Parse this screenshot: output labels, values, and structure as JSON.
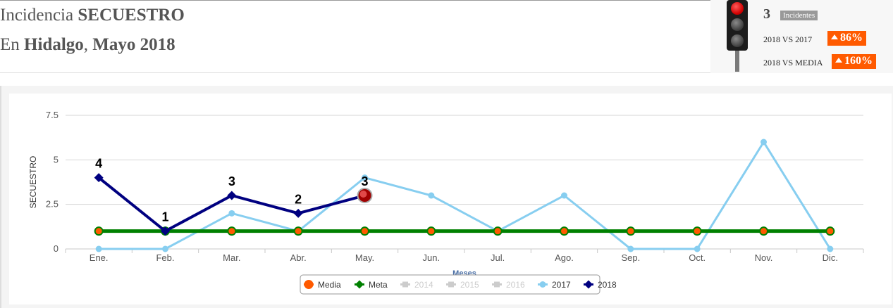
{
  "header": {
    "line1_prefix": "Incidencia ",
    "line1_bold": "SECUESTRO",
    "line2_prefix": "En ",
    "line2_bold1": "Hidalgo",
    "line2_sep": ", ",
    "line2_bold2": "Mayo 2018"
  },
  "kpi": {
    "count": "3",
    "count_label": "Incidentes",
    "row1_label": "2018 VS 2017",
    "row1_value": "86%",
    "row2_label": "2018 VS MEDIA",
    "row2_value": "160%",
    "badge_color": "#ff5a00",
    "traffic_light_state": "red"
  },
  "chart_data": {
    "type": "line",
    "ylabel": "SECUESTRO",
    "xlabel": "Meses",
    "ylim": [
      0,
      7.5
    ],
    "yticks": [
      0,
      2.5,
      5,
      7.5
    ],
    "grid": true,
    "legend_position": "bottom-center",
    "categories": [
      "Ene.",
      "Feb.",
      "Mar.",
      "Abr.",
      "May.",
      "Jun.",
      "Jul.",
      "Ago.",
      "Sep.",
      "Oct.",
      "Nov.",
      "Dic."
    ],
    "series": [
      {
        "name": "Media",
        "color": "#ff5a00",
        "visible": true,
        "legend_only": true,
        "values": []
      },
      {
        "name": "Meta",
        "color": "#008000",
        "visible": true,
        "values": [
          1,
          1,
          1,
          1,
          1,
          1,
          1,
          1,
          1,
          1,
          1,
          1
        ]
      },
      {
        "name": "2014",
        "color": "#cccccc",
        "visible": false,
        "values": []
      },
      {
        "name": "2015",
        "color": "#cccccc",
        "visible": false,
        "values": []
      },
      {
        "name": "2016",
        "color": "#cccccc",
        "visible": false,
        "values": []
      },
      {
        "name": "2017",
        "color": "#87cef0",
        "visible": true,
        "values": [
          0,
          0,
          2,
          1,
          4,
          3,
          1,
          3,
          0,
          0,
          6,
          0
        ]
      },
      {
        "name": "2018",
        "color": "#000080",
        "visible": true,
        "values": [
          4,
          1,
          3,
          2,
          3
        ],
        "data_labels": [
          "4",
          "1",
          "3",
          "2",
          "3"
        ]
      }
    ]
  }
}
